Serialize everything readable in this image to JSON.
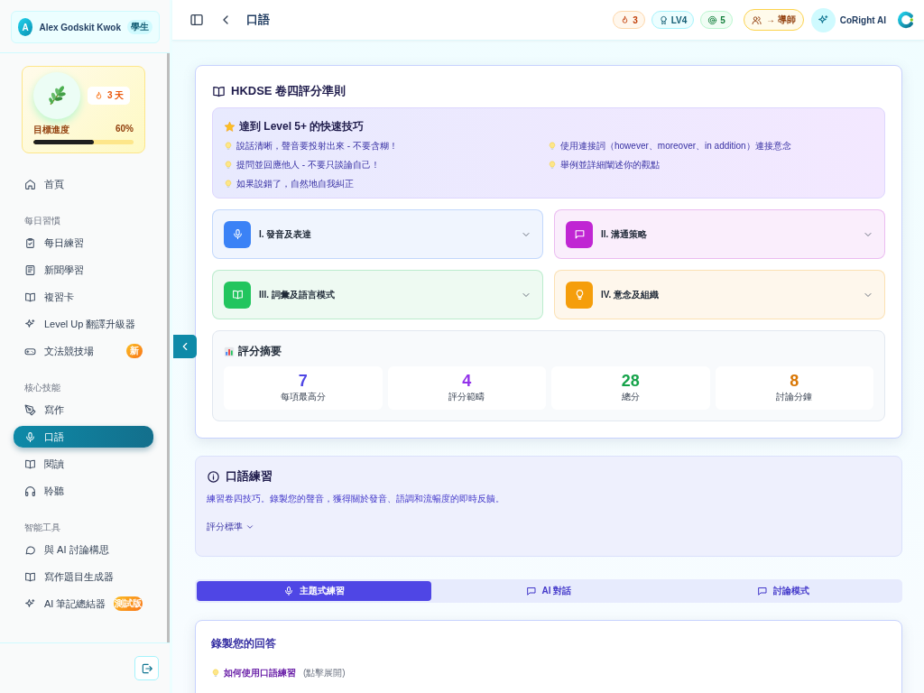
{
  "user": {
    "avatar": "A",
    "name": "Alex Godskit Kwok",
    "role": "學生"
  },
  "streak_card": {
    "streak": "3 天",
    "progress_label": "目標進度",
    "progress_value": "60%",
    "level": 0.6
  },
  "nav": [
    {
      "items": [
        {
          "label": "首頁",
          "selected": false
        }
      ]
    },
    {
      "section": "每日習慣",
      "items": [
        {
          "label": "每日練習",
          "selected": false
        },
        {
          "label": "新聞學習",
          "selected": false
        },
        {
          "label": "複習卡",
          "selected": false
        },
        {
          "label": "Level Up 翻譯升級器",
          "selected": false
        },
        {
          "label": "文法競技場",
          "selected": false,
          "badge": "新"
        }
      ]
    },
    {
      "section": "核心技能",
      "items": [
        {
          "label": "寫作",
          "selected": false
        },
        {
          "label": "口語",
          "selected": true
        },
        {
          "label": "閱讀",
          "selected": false
        },
        {
          "label": "聆聽",
          "selected": false
        }
      ]
    },
    {
      "section": "智能工具",
      "items": [
        {
          "label": "與 AI 討論構思",
          "selected": false
        },
        {
          "label": "寫作題目生成器",
          "selected": false
        },
        {
          "label": "AI 筆記總結器",
          "selected": false,
          "badge": "測試版"
        }
      ]
    }
  ],
  "header": {
    "title": "口語",
    "streak": "3",
    "level": "LV4",
    "points": "5",
    "tutor": "→ 導師",
    "assistant": "CoRight AI"
  },
  "rubric": {
    "title": "HKDSE 卷四評分準則",
    "tips_title": "達到 Level 5+ 的快速技巧",
    "tips": [
      "說話清晰，聲音要投射出來 - 不要含糊！",
      "使用連接詞（however、moreover、in addition）連接意念",
      "提問並回應他人 - 不要只談論自己！",
      "舉例並詳細闡述你的觀點",
      "如果說錯了，自然地自我糾正"
    ],
    "criteria": [
      {
        "label": "I. 發音及表達",
        "color": "#3b82f6",
        "expanded": false
      },
      {
        "label": "II. 溝通策略",
        "color": "#c026d3",
        "expanded": false
      },
      {
        "label": "III. 詞彙及語言模式",
        "color": "#22c55e",
        "expanded": false
      },
      {
        "label": "IV. 意念及組織",
        "color": "#f59e0b",
        "expanded": false
      }
    ],
    "summary_title": "評分摘要",
    "stats": [
      {
        "value": "7",
        "label": "每項最高分",
        "color": "#4f46e5"
      },
      {
        "value": "4",
        "label": "評分範疇",
        "color": "#9333ea"
      },
      {
        "value": "28",
        "label": "總分",
        "color": "#16a34a"
      },
      {
        "value": "8",
        "label": "討論分鐘",
        "color": "#d97706"
      }
    ]
  },
  "practice_info": {
    "title": "口語練習",
    "description": "練習卷四技巧。錄製您的聲音，獲得關於發音、語調和流暢度的即時反饋。",
    "link": "評分標準"
  },
  "modes": [
    {
      "label": "主題式練習",
      "selected": true
    },
    {
      "label": "AI 對話",
      "selected": false
    },
    {
      "label": "討論模式",
      "selected": false
    }
  ],
  "record": {
    "title": "錄製您的回答",
    "help": "如何使用口語練習",
    "help_hint": "(點擊展開)"
  }
}
